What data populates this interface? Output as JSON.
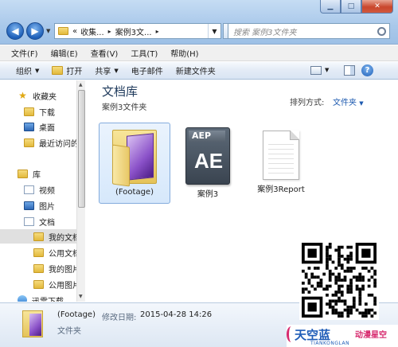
{
  "address": {
    "prefix": "«",
    "crumbs": [
      "收集...",
      "案例3文..."
    ],
    "separator": "▸"
  },
  "search": {
    "placeholder": "搜索 案例3文件夹"
  },
  "menu": [
    "文件(F)",
    "编辑(E)",
    "查看(V)",
    "工具(T)",
    "帮助(H)"
  ],
  "commands": {
    "organize": "组织",
    "open": "打开",
    "share": "共享",
    "email": "电子邮件",
    "new_folder": "新建文件夹"
  },
  "nav": {
    "favorites": "收藏夹",
    "downloads": "下载",
    "desktop": "桌面",
    "recent": "最近访问的",
    "libraries": "库",
    "videos": "视频",
    "pictures": "图片",
    "documents": "文档",
    "my_docs": "我的文档",
    "public_docs": "公用文档",
    "my_pictures": "我的图片",
    "public_pictures": "公用图片",
    "thunder": "迅雷下载"
  },
  "library": {
    "title": "文档库",
    "subtitle": "案例3文件夹",
    "arrange_label": "排列方式:",
    "arrange_value": "文件夹"
  },
  "files": [
    {
      "name": "(Footage)",
      "type": "folder"
    },
    {
      "name": "案例3",
      "type": "aep",
      "badge": "AEP",
      "glyph": "AE"
    },
    {
      "name": "案例3Report",
      "type": "text"
    }
  ],
  "details": {
    "name": "(Footage)",
    "modified_label": "修改日期:",
    "modified_value": "2015-04-28 14:26",
    "type": "文件夹"
  },
  "watermark": {
    "brand": "天空蓝",
    "brand_accent": "动漫星空",
    "brand_sub": "TIANKONGLAN"
  },
  "colors": {
    "accent_blue": "#1e5bb0",
    "title_text": "#1e395b",
    "selection": "#d6e8fb",
    "logo_pink": "#d72a6e"
  }
}
